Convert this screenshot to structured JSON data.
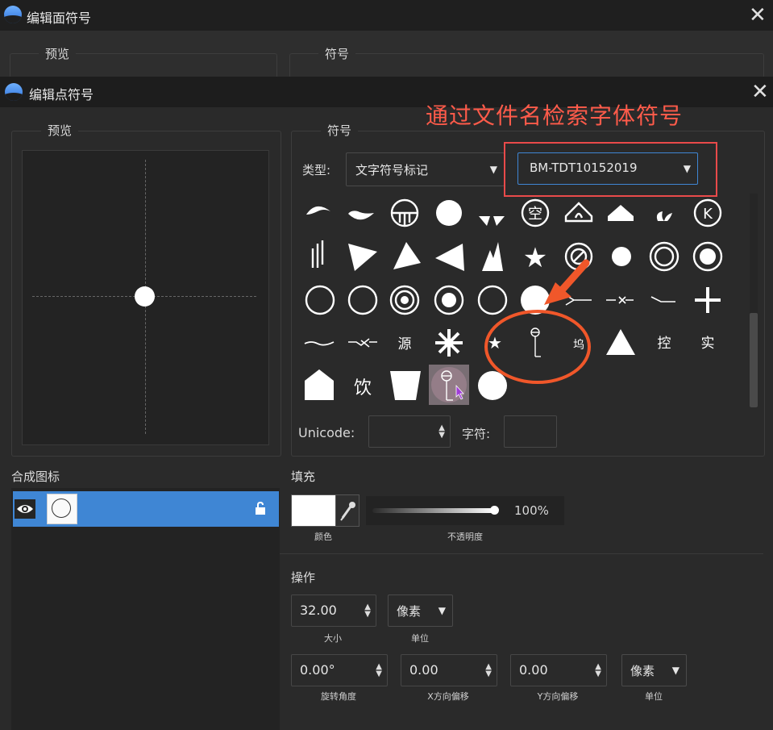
{
  "back_window": {
    "title": "编辑面符号",
    "preview_legend": "预览",
    "symbol_legend": "符号"
  },
  "front_window": {
    "title": "编辑点符号",
    "preview_legend": "预览",
    "symbol_legend": "符号",
    "type_label": "类型:",
    "type_value": "文字符号标记",
    "font_value": "BM-TDT10152019",
    "unicode_label": "Unicode:",
    "unicode_value": "",
    "char_label": "字符:",
    "char_value": ""
  },
  "annotation": {
    "text": "通过文件名检索字体符号",
    "color": "#ff5b4a"
  },
  "symbols": [
    [
      "wave-hook",
      "leaf-curve",
      "circle-grid",
      "filled-circle",
      "split-wedges",
      "空",
      "house-lotus",
      "house-half",
      "sprout",
      "Ⓚ"
    ],
    [
      "vertical-lines",
      "triangle-down-right",
      "triangle-right",
      "triangle-left",
      "twin-peaks",
      "★",
      "circle-arrow",
      "small-dot",
      "ring-double",
      "ring-dot"
    ],
    [
      "ring",
      "ring",
      "ring-target",
      "ring-dot-big",
      "ring",
      "filled-circle-large",
      "arrow-lines",
      "arrow-small",
      "line-hook",
      "+"
    ],
    [
      "line-wave",
      "line-x",
      "源",
      "✳",
      "★",
      "pin-symbol",
      "wall-symbol",
      "▲",
      "控",
      "实"
    ],
    [
      "house",
      "饮",
      "trapezoid",
      "pin-selected",
      "filled-circle"
    ]
  ],
  "composite": {
    "label": "合成图标"
  },
  "fill": {
    "label": "填充",
    "color_label": "颜色",
    "color": "#ffffff",
    "opacity_label": "不透明度",
    "opacity_value": "100%",
    "opacity": 1.0
  },
  "operation": {
    "label": "操作",
    "size_value": "32.00",
    "size_label": "大小",
    "unit_value": "像素",
    "unit_label": "单位",
    "rotation_value": "0.00°",
    "rotation_label": "旋转角度",
    "x_offset_value": "0.00",
    "x_offset_label": "X方向偏移",
    "y_offset_value": "0.00",
    "y_offset_label": "Y方向偏移",
    "unit2_value": "像素",
    "unit2_label": "单位"
  }
}
